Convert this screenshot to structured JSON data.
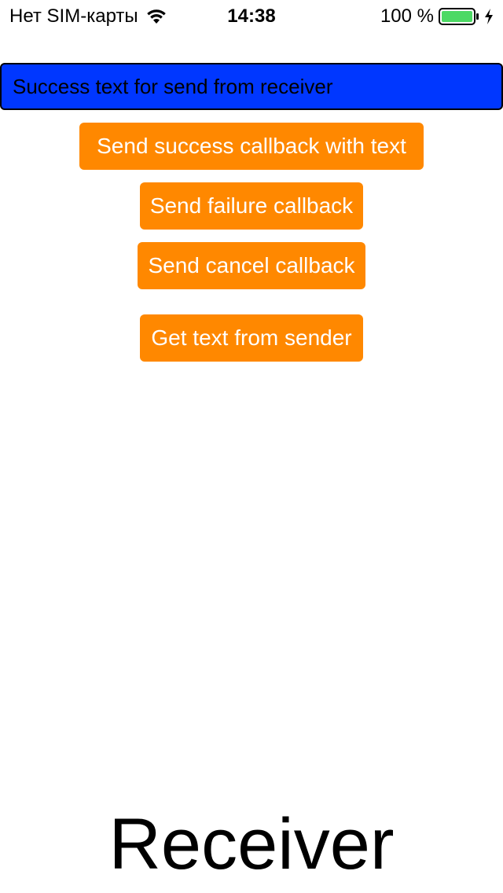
{
  "status_bar": {
    "carrier": "Нет SIM-карты",
    "time": "14:38",
    "battery_percent": "100 %",
    "battery_color": "#4cd964",
    "wifi_icon": "wifi-icon",
    "battery_icon": "battery-icon",
    "charging_icon": "charging-bolt-icon"
  },
  "text_field": {
    "value": "Success text for send from receiver",
    "background": "#0037ff"
  },
  "buttons": {
    "send_success": "Send success callback with text",
    "send_failure": "Send failure callback",
    "send_cancel": "Send cancel callback",
    "get_text": "Get text from sender",
    "color": "#ff8800"
  },
  "footer": {
    "title": "Receiver"
  }
}
